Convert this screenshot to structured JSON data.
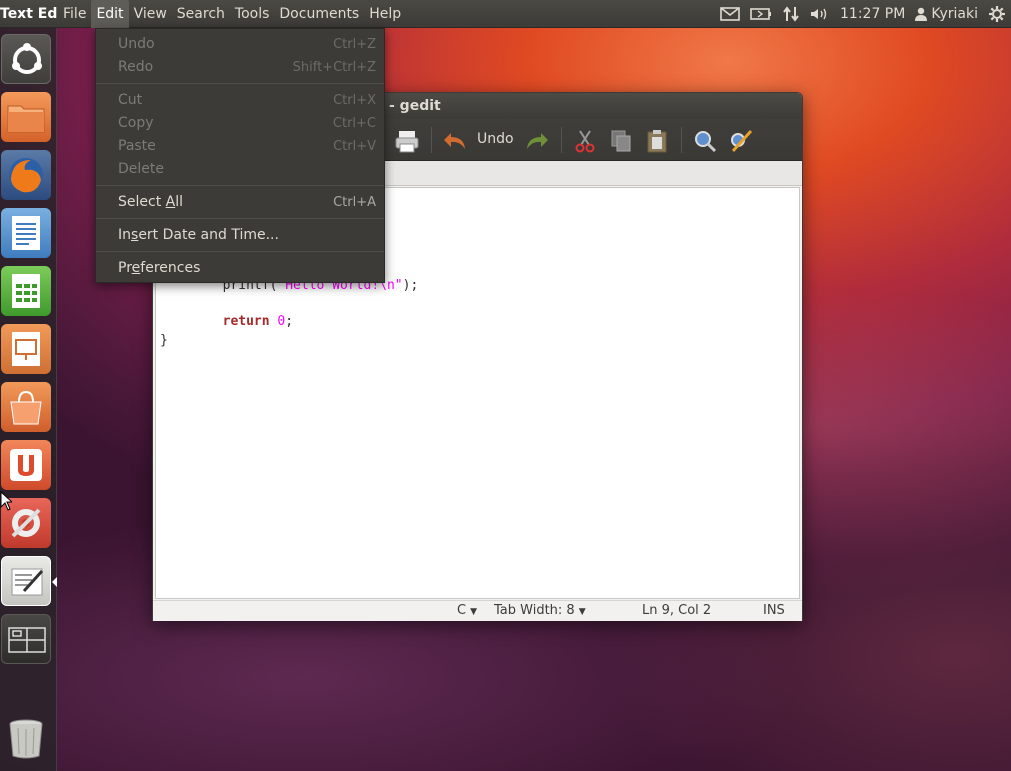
{
  "panel": {
    "app_name": "Text Editor",
    "menus": [
      "File",
      "Edit",
      "View",
      "Search",
      "Tools",
      "Documents",
      "Help"
    ],
    "time": "11:27 PM",
    "user": "Kyriaki",
    "indicator_icons": [
      "mail-icon",
      "battery-icon",
      "network-icon",
      "volume-icon",
      "power-gear-icon"
    ]
  },
  "launcher": {
    "items": [
      "ubuntu-dash",
      "home-folder",
      "firefox",
      "libreoffice-writer",
      "libreoffice-calc",
      "libreoffice-impress",
      "ubuntu-software-center",
      "ubuntu-one",
      "system-settings",
      "gedit",
      "workspace-switcher",
      "trash"
    ]
  },
  "edit_menu": {
    "items": [
      {
        "label": "Undo",
        "accel": "Ctrl+Z",
        "enabled": false
      },
      {
        "label": "Redo",
        "accel": "Shift+Ctrl+Z",
        "enabled": false
      },
      {
        "label": "Cut",
        "accel": "Ctrl+X",
        "enabled": false
      },
      {
        "label": "Copy",
        "accel": "Ctrl+C",
        "enabled": false
      },
      {
        "label": "Paste",
        "accel": "Ctrl+V",
        "enabled": false
      },
      {
        "label": "Delete",
        "accel": "",
        "enabled": false
      },
      {
        "label_pre": "Select ",
        "label_u": "A",
        "label_post": "ll",
        "accel": "Ctrl+A",
        "enabled": true
      },
      {
        "label_pre": "In",
        "label_u": "s",
        "label_post": "ert Date and Time...",
        "accel": "",
        "enabled": true
      },
      {
        "label_pre": "Pr",
        "label_u": "e",
        "label_post": "ferences",
        "accel": "",
        "enabled": true
      }
    ]
  },
  "window": {
    "title": "- gedit",
    "toolbar": {
      "undo_label": "Undo"
    },
    "code": {
      "line_printf_pre": "        printf(",
      "line_printf_str": "\"Hello World!\\n\"",
      "line_printf_post": ");",
      "line_return_indent": "        ",
      "line_return_kw": "return",
      "line_return_num": "0",
      "line_return_post": ";",
      "line_close": "}"
    },
    "status": {
      "language": "C",
      "tab_width": "Tab Width: 8",
      "position": "Ln 9, Col 2",
      "mode": "INS"
    }
  }
}
